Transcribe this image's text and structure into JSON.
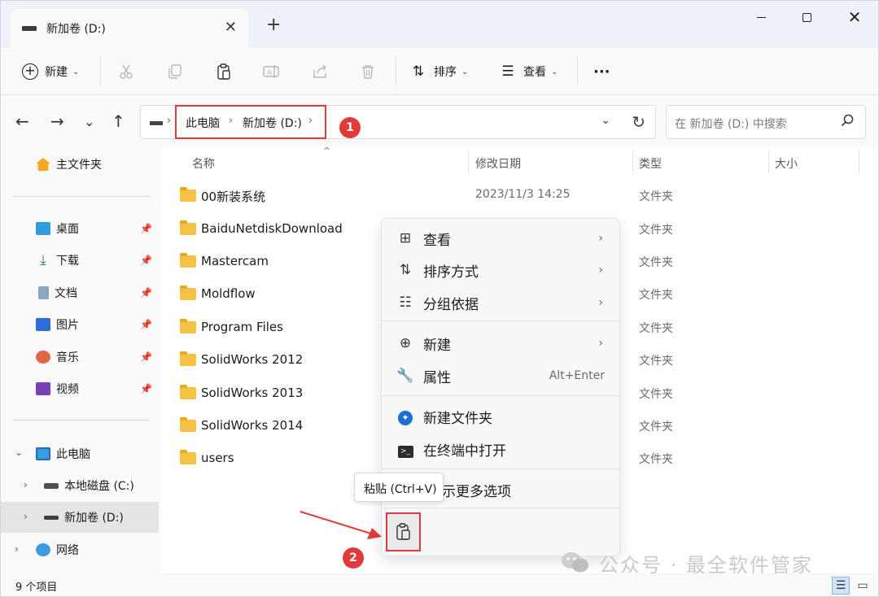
{
  "window": {
    "tab_title": "新加卷 (D:)",
    "new_tab": "+",
    "close_tab": "✕",
    "minimize": "",
    "maximize": "",
    "close": "✕"
  },
  "toolbar": {
    "new_label": "新建",
    "sort_label": "排序",
    "view_label": "查看",
    "more": "···"
  },
  "address": {
    "crumbs": [
      "此电脑",
      "新加卷 (D:)"
    ],
    "search_placeholder": "在 新加卷 (D:) 中搜索"
  },
  "annotations": {
    "badge1": "1",
    "badge2": "2",
    "accent": "#e23a3a"
  },
  "sidebar": {
    "home": "主文件夹",
    "quick": [
      {
        "label": "桌面",
        "icon": "desktop-icon",
        "color": "#2f9be0"
      },
      {
        "label": "下载",
        "icon": "download-icon",
        "color": "#2a8a5f"
      },
      {
        "label": "文档",
        "icon": "document-icon",
        "color": "#5b7fa6"
      },
      {
        "label": "图片",
        "icon": "pictures-icon",
        "color": "#2d6fd6"
      },
      {
        "label": "音乐",
        "icon": "music-icon",
        "color": "#e0664a"
      },
      {
        "label": "视频",
        "icon": "video-icon",
        "color": "#7a3fb5"
      }
    ],
    "this_pc": "此电脑",
    "drives": [
      {
        "label": "本地磁盘 (C:)",
        "icon": "drive-c-icon"
      },
      {
        "label": "新加卷 (D:)",
        "icon": "drive-d-icon"
      }
    ],
    "network": "网络"
  },
  "list": {
    "columns": {
      "name": "名称",
      "date": "修改日期",
      "type": "类型",
      "size": "大小"
    },
    "rows": [
      {
        "name": "00新装系统",
        "date": "2023/11/3 14:25",
        "type": "文件夹"
      },
      {
        "name": "BaiduNetdiskDownload",
        "date": "",
        "type": "文件夹"
      },
      {
        "name": "Mastercam",
        "date": "",
        "type": "文件夹"
      },
      {
        "name": "Moldflow",
        "date": "",
        "type": "文件夹"
      },
      {
        "name": "Program Files",
        "date": "",
        "type": "文件夹"
      },
      {
        "name": "SolidWorks 2012",
        "date": "",
        "type": "文件夹"
      },
      {
        "name": "SolidWorks 2013",
        "date": "",
        "type": "文件夹"
      },
      {
        "name": "SolidWorks 2014",
        "date": "",
        "type": "文件夹"
      },
      {
        "name": "users",
        "date": "",
        "type": "文件夹"
      }
    ]
  },
  "context_menu": {
    "view": "查看",
    "sort": "排序方式",
    "group": "分组依据",
    "new": "新建",
    "properties": "属性",
    "properties_shortcut": "Alt+Enter",
    "new_folder": "新建文件夹",
    "open_terminal": "在终端中打开",
    "more_options": "示更多选项",
    "paste_tooltip": "粘贴 (Ctrl+V)"
  },
  "status": {
    "count": "9 个项目"
  },
  "watermark": "公众号 · 最全软件管家"
}
